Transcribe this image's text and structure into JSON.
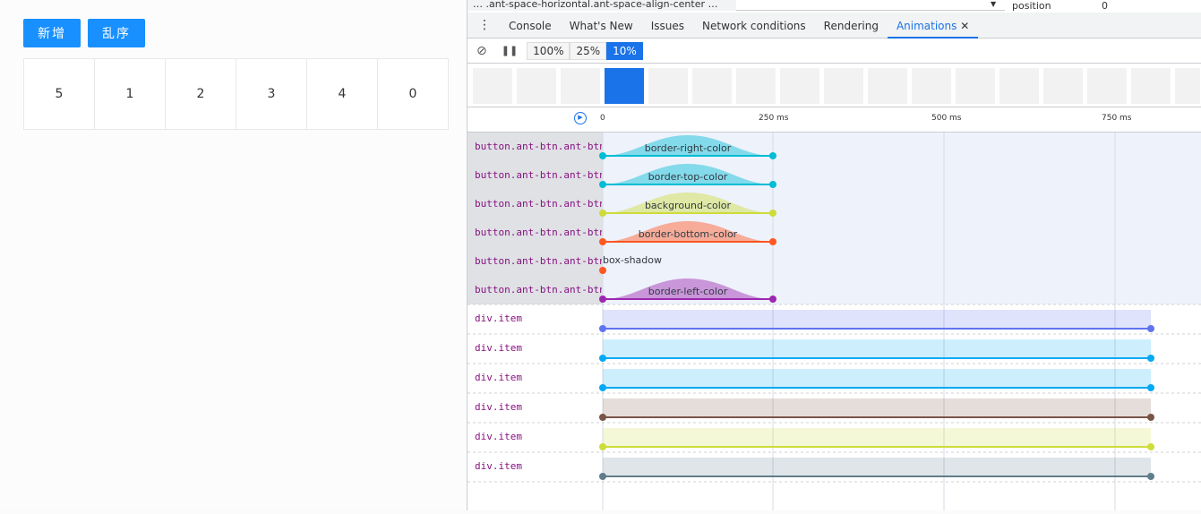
{
  "page": {
    "buttons": {
      "add": "新增",
      "shuffle": "乱序"
    },
    "items": [
      "5",
      "1",
      "2",
      "3",
      "4",
      "0"
    ]
  },
  "devtools": {
    "breadcrumb": "…  .ant-space-horizontal.ant-space-align-center  …",
    "styles": {
      "property": "position",
      "value": "0"
    },
    "tabs": [
      "Console",
      "What's New",
      "Issues",
      "Network conditions",
      "Rendering",
      "Animations"
    ],
    "active_tab": "Animations",
    "speeds": [
      "100%",
      "25%",
      "10%"
    ],
    "active_speed": "10%",
    "ruler_ticks": [
      "0",
      "250 ms",
      "500 ms",
      "750 ms"
    ],
    "button_group": {
      "selector": "button.ant-btn.ant-btn",
      "animations": [
        {
          "name": "border-right-color",
          "color": "#00bcd4"
        },
        {
          "name": "border-top-color",
          "color": "#00bcd4"
        },
        {
          "name": "background-color",
          "color": "#cddc39"
        },
        {
          "name": "border-bottom-color",
          "color": "#ff5722"
        },
        {
          "name": "box-shadow",
          "color": "#ff5722"
        },
        {
          "name": "border-left-color",
          "color": "#9c27b0"
        }
      ]
    },
    "item_group": {
      "selector": "div.item",
      "colors": [
        "#6174f0",
        "#03a9f4",
        "#03a9f4",
        "#795548",
        "#cddc39",
        "#607d8b"
      ]
    }
  }
}
